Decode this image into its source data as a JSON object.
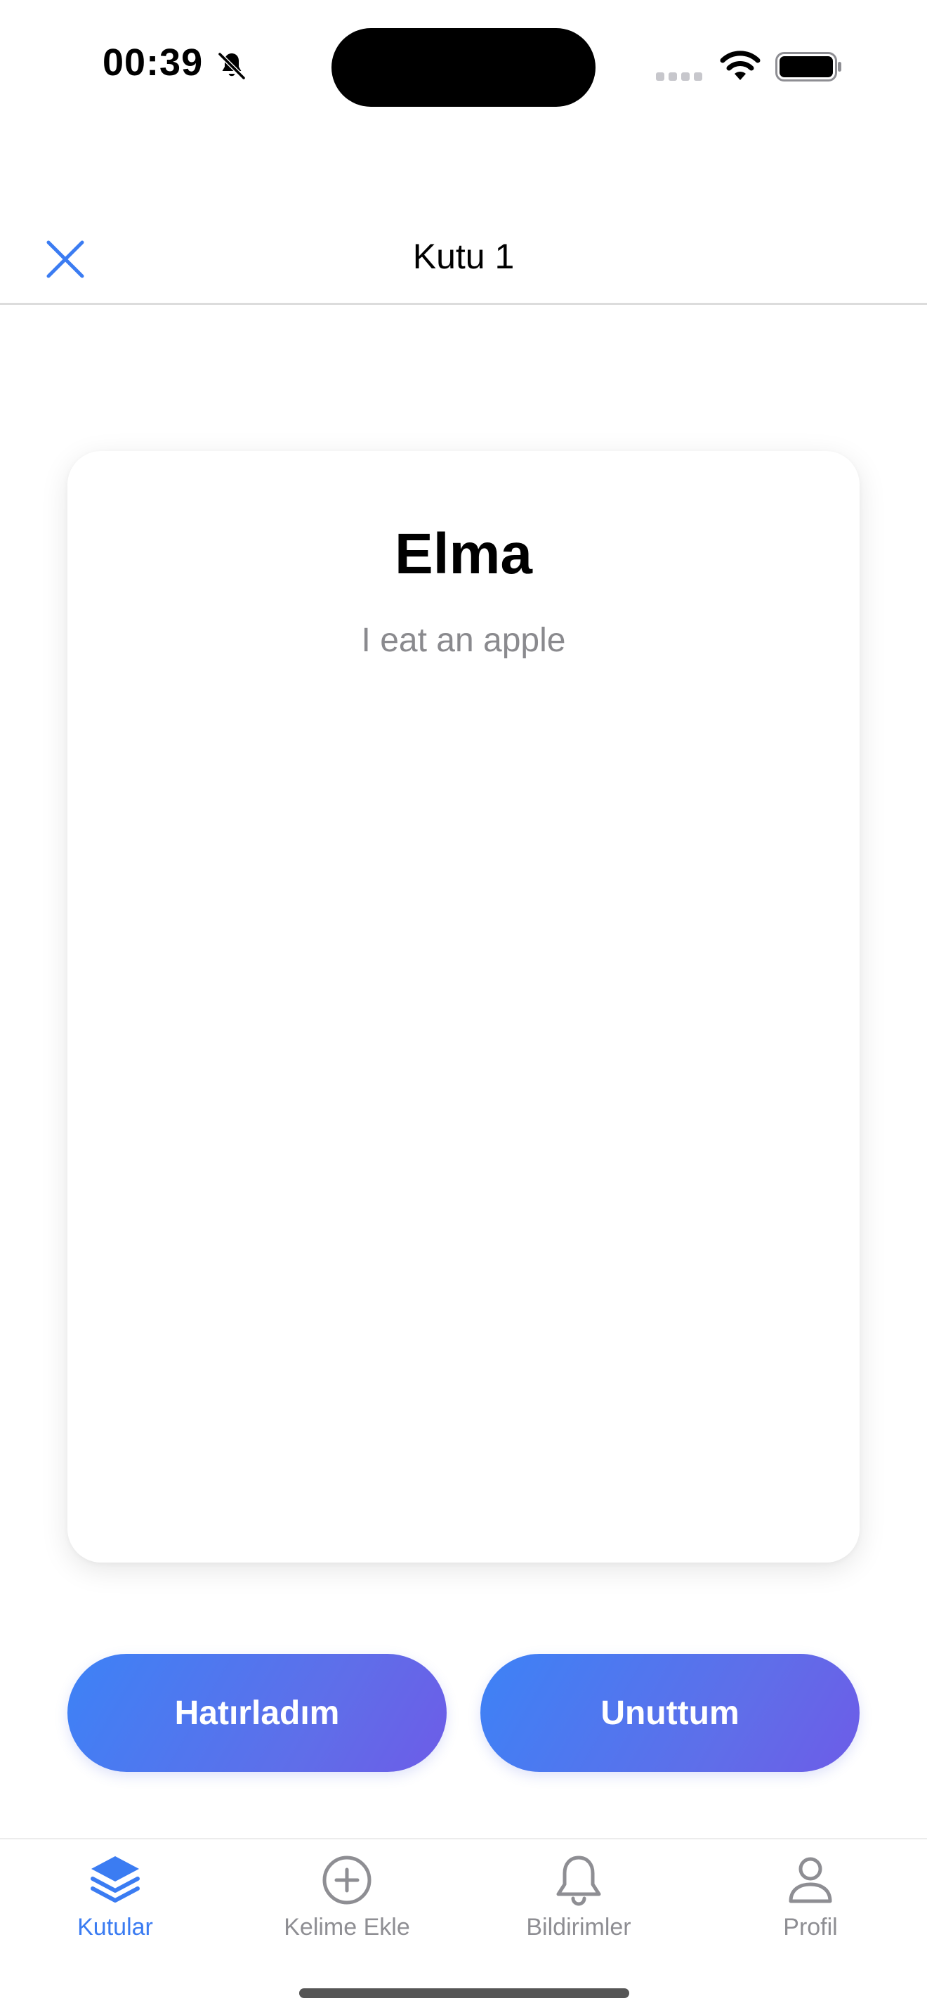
{
  "status_bar": {
    "time": "00:39",
    "icons": [
      "bell-slash-icon",
      "signal-icon",
      "wifi-icon",
      "battery-icon"
    ]
  },
  "nav": {
    "title": "Kutu 1",
    "close_icon": "close-icon"
  },
  "card": {
    "word": "Elma",
    "example": "I eat an apple"
  },
  "actions": {
    "remembered": "Hatırladım",
    "forgot": "Unuttum"
  },
  "tabs": [
    {
      "label": "Kutular",
      "icon": "stack-icon",
      "active": true
    },
    {
      "label": "Kelime Ekle",
      "icon": "plus-circle-icon",
      "active": false
    },
    {
      "label": "Bildirimler",
      "icon": "bell-icon",
      "active": false
    },
    {
      "label": "Profil",
      "icon": "person-icon",
      "active": false
    }
  ],
  "colors": {
    "accent": "#3b7cf2",
    "gradient_start": "#3d82f6",
    "gradient_end": "#6d5ce7",
    "inactive": "#8e8e93",
    "secondary_text": "#8a8a8e"
  }
}
